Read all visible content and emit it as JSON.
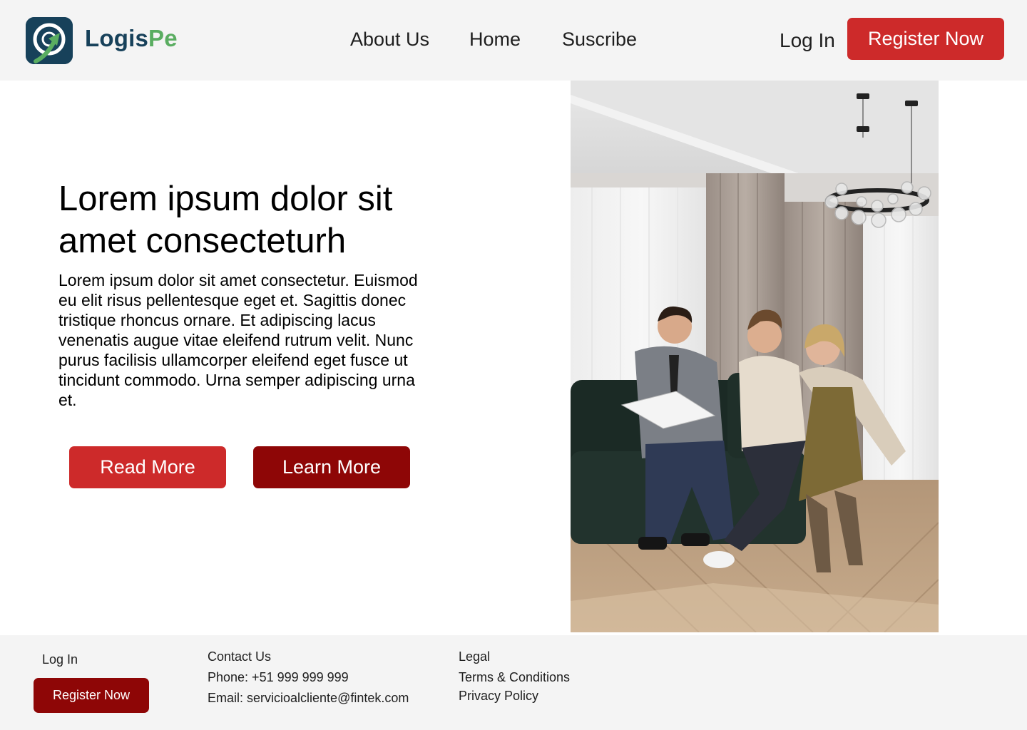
{
  "brand": {
    "name_part1": "Logis",
    "name_part2": "Pe",
    "color_dark": "#17415a",
    "color_green": "#5aad61",
    "logo_icon": "logo-arrow-icon"
  },
  "nav": {
    "items": [
      {
        "label": "About Us"
      },
      {
        "label": "Home"
      },
      {
        "label": "Suscribe"
      }
    ],
    "login_label": "Log In",
    "register_label": "Register Now"
  },
  "hero": {
    "title": "Lorem ipsum dolor sit amet consecteturh",
    "body": "Lorem ipsum dolor sit amet consectetur. Euismod eu elit risus pellentesque eget et. Sagittis donec tristique rhoncus ornare. Et adipiscing lacus venenatis augue vitae eleifend rutrum velit. Nunc purus facilisis ullamcorper eleifend eget fusce ut tincidunt commodo. Urna semper adipiscing urna et.",
    "read_more_label": "Read More",
    "learn_more_label": "Learn More"
  },
  "footer": {
    "login_label": "Log In",
    "register_label": "Register Now",
    "contact": {
      "heading": "Contact Us",
      "phone": "Phone: +51 999 999 999",
      "email": "Email: servicioalcliente@fintek.com"
    },
    "legal": {
      "heading": "Legal",
      "terms": "Terms & Conditions",
      "privacy": "Privacy Policy"
    }
  },
  "colors": {
    "primary_red": "#cd2a2a",
    "dark_red": "#8e0606",
    "header_bg": "#f4f4f4"
  }
}
